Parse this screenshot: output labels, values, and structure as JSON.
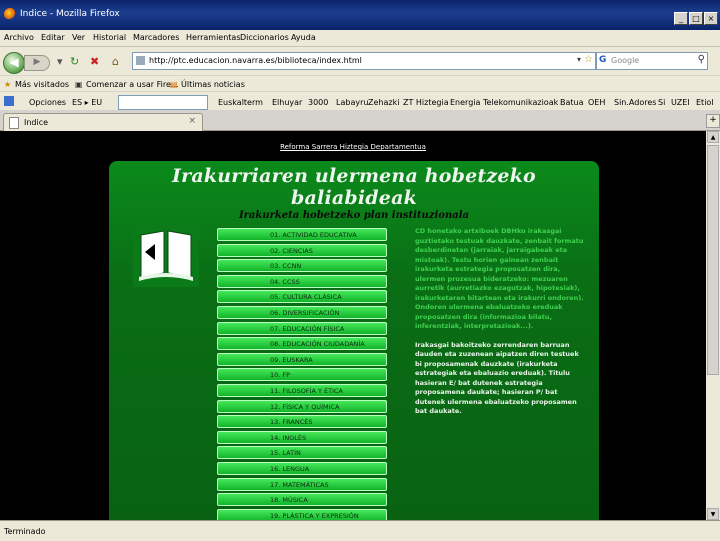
{
  "window": {
    "title": "Indice - Mozilla Firefox",
    "controls": [
      "_",
      "□",
      "×"
    ]
  },
  "menubar": {
    "items": [
      "Archivo",
      "Editar",
      "Ver",
      "Historial",
      "Marcadores",
      "Herramientas",
      "Diccionarios",
      "Ayuda"
    ]
  },
  "navbar": {
    "url": "http://ptc.educacion.navarra.es/biblioteca/index.html",
    "search_engine": "G",
    "search_placeholder": "Google",
    "icons": [
      "back-icon",
      "forward-icon",
      "reload-icon",
      "stop-icon",
      "home-icon",
      "bookmark-star-icon",
      "search-icon"
    ]
  },
  "bookmarks": {
    "items": [
      "Más visitados",
      "Comenzar a usar Fire...",
      "Últimas noticias"
    ]
  },
  "toolbar": {
    "options": "Opciones",
    "lang": "ES ▸ EU",
    "links": [
      "Euskalterm",
      "Elhuyar",
      "3000",
      "Labayru",
      "Zehazki",
      "ZT Hiztegia",
      "Energia",
      "Telekomunikazioak",
      "Batua",
      "OEH",
      "Sin.Adores",
      "Si",
      "UZEI",
      "Etiol"
    ]
  },
  "tab": {
    "label": "Indice"
  },
  "page": {
    "top_links": "Reforma  Sarrera  Hiztegia  Departamentua",
    "title": "Irakurriaren ulermena hobetzeko baliabideak",
    "subtitle": "Irakurketa hobetzeko plan instituzionala",
    "menu": [
      "01. ACTIVIDAD EDUCATIVA",
      "02. CIENCIAS",
      "03. CCNN",
      "04. CCSS",
      "05. CULTURA CLÁSICA",
      "06. DIVERSIFICACIÓN",
      "07. EDUCACIÓN FÍSICA",
      "08. EDUCACIÓN CIUDADANÍA",
      "09. EUSKARA",
      "10. FP",
      "11. FILOSOFÍA Y ÉTICA",
      "12. FÍSICA Y QUÍMICA",
      "13. FRANCÉS",
      "14. INGLÉS",
      "15. LATÍN",
      "16. LENGUA",
      "17. MATEMÁTICAS",
      "18. MÚSICA",
      "19. PLÁSTICA Y EXPRESIÓN"
    ],
    "desc_p1": "CD honetako artxiboek DBHko irakasgai guztietako testuak dauzkate, zenbait formatu desberdinetan (jarraiak, jarraigabeak eta mistoak). Testu horien gainean zenbait irakurketa estrategia proposatzen dira, ulermen prozesua bideratzeko: mezuaren aurretik (aurretiazko ezagutzak, hipotesiak), irakurketaren bitartean eta irakurri ondoren). Ondoren ulermena ebaluatzeko ereduak proposatzen dira (informazioa bilatu, inferentziak, interpretazioak...).",
    "desc_p2": "Irakasgai bakoitzeko zerrendaren barruan dauden eta zuzenean aipatzen diren testuek bi proposamenak dauzkate (irakurketa estrategiak eta ebaluazio ereduak). Titulu hasieran E/ bat dutenek estrategia proposamena daukate; hasieran P/ bat dutenek ulermena ebaluatzeko proposamen bat daukate."
  },
  "status": {
    "text": "Terminado"
  }
}
